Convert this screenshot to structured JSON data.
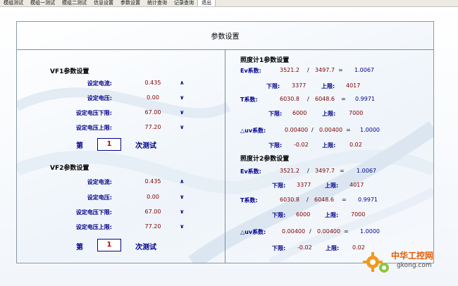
{
  "menu": [
    "模组测试",
    "模组一测试",
    "模组二测试",
    "信息设置",
    "参数设置",
    "统计查询",
    "记录查询",
    "退出"
  ],
  "selected_menu": "参数设置",
  "panel_title": "参数设置",
  "vf1": {
    "title": "VF1参数设置",
    "rows": [
      {
        "label": "设定电流:",
        "value": "0.435",
        "arrow": "∧"
      },
      {
        "label": "设定电压:",
        "value": "0.00",
        "arrow": "∨"
      },
      {
        "label": "设定电压下限:",
        "value": "67.00",
        "arrow": "∨"
      },
      {
        "label": "设定电压上限:",
        "value": "77.20",
        "arrow": "∨"
      }
    ],
    "round_prefix": "第",
    "round_value": "1",
    "round_suffix": "次测试"
  },
  "vf2": {
    "title": "VF2参数设置",
    "rows": [
      {
        "label": "设定电流:",
        "value": "0.435",
        "arrow": "∧"
      },
      {
        "label": "设定电压:",
        "value": "0.00",
        "arrow": "∨"
      },
      {
        "label": "设定电压下限:",
        "value": "67.00",
        "arrow": "∨"
      },
      {
        "label": "设定电压上限:",
        "value": "77.20",
        "arrow": "∨"
      }
    ],
    "round_prefix": "第",
    "round_value": "1",
    "round_suffix": "次测试"
  },
  "meter1": {
    "title": "照度计1参数设置",
    "ev": {
      "label": "Ev系数:",
      "a": "3521.2",
      "op": "/",
      "b": "3497.7",
      "eq": "=",
      "res": "1.0067"
    },
    "ev_limits": {
      "lo_label": "下限:",
      "lo": "3377",
      "hi_label": "上限:",
      "hi": "4017"
    },
    "t": {
      "label": "T系数:",
      "a": "6030.8",
      "op": "/",
      "b": "6048.6",
      "eq": "=",
      "res": "0.9971"
    },
    "t_limits": {
      "lo_label": "下限:",
      "lo": "6000",
      "hi_label": "上限:",
      "hi": "7000"
    },
    "uv": {
      "label": "△uv系数:",
      "a": "0.00400",
      "op": "/",
      "b": "0.00400",
      "eq": "=",
      "res": "1.0000"
    },
    "uv_limits": {
      "lo_label": "下限:",
      "lo": "-0.02",
      "hi_label": "上限:",
      "hi": "0.02"
    }
  },
  "meter2": {
    "title": "照度计2参数设置",
    "ev": {
      "label": "Ev系数:",
      "a": "3521.2",
      "op": "/",
      "b": "3497.7",
      "eq": "=",
      "res": "1.0067"
    },
    "ev_limits": {
      "lo_label": "下限:",
      "lo": "3377",
      "hi_label": "上限:",
      "hi": "4017"
    },
    "t": {
      "label": "T系数:",
      "a": "6030.8",
      "op": "/",
      "b": "6048.6",
      "eq": "=",
      "res": "0.9971"
    },
    "t_limits": {
      "lo_label": "下限:",
      "lo": "6000",
      "hi_label": "上限:",
      "hi": "7000"
    },
    "uv": {
      "label": "△uv系数:",
      "a": "0.00400",
      "op": "/",
      "b": "0.00400",
      "eq": "=",
      "res": "1.0000"
    },
    "uv_limits": {
      "lo_label": "下限:",
      "lo": "-0.02",
      "hi_label": "上限:",
      "hi": "0.02"
    }
  },
  "watermark": {
    "cn": "中华工控网",
    "en": "gkong.com"
  },
  "colors": {
    "label": "#00008b",
    "value": "#7b0000",
    "accent": "#c00000"
  }
}
